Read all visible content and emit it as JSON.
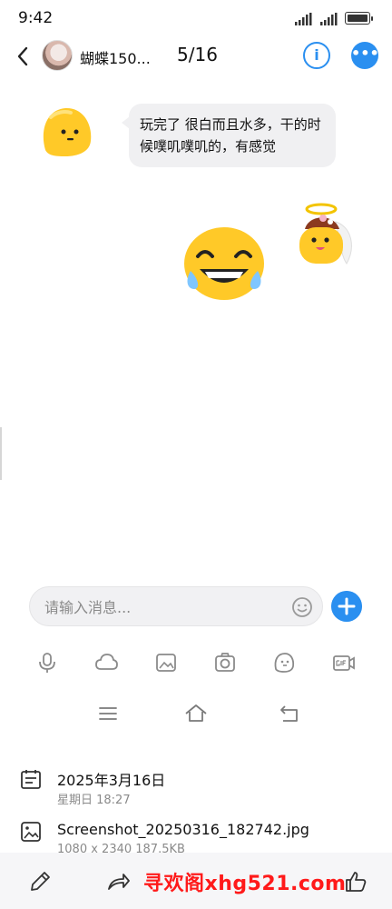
{
  "status_bar": {
    "time": "9:42"
  },
  "header": {
    "contact_name": "蝴蝶150...",
    "counter": "5/16",
    "info_icon": "info-icon",
    "more_icon": "more-icon"
  },
  "chat": {
    "incoming_message": "玩完了 很白而且水多，干的时候噗叽噗叽的，有感觉",
    "incoming_avatar": "yellow-blob-emoji",
    "sticker_angel": "angel-emoji-sticker",
    "sticker_laugh": "laughing-tears-emoji"
  },
  "composer": {
    "placeholder": "请输入消息...",
    "emoji_icon": "smile-icon",
    "send_icon": "plus-icon"
  },
  "toolbar": [
    "microphone-icon",
    "cloud-icon",
    "image-icon",
    "camera-icon",
    "sticker-icon",
    "gif-icon"
  ],
  "system_nav": [
    "menu-icon",
    "home-icon",
    "back-icon"
  ],
  "file_info": {
    "date": "2025年3月16日",
    "day_time": "星期日 18:27",
    "filename": "Screenshot_20250316_182742.jpg",
    "details": "1080 x 2340 187.5KB"
  },
  "bottom_actions": [
    "edit-icon",
    "share-icon",
    "like-icon"
  ],
  "watermark": "寻欢阁xhg521.com",
  "colors": {
    "accent": "#2a8ff0",
    "bubble": "#f0f0f2",
    "watermark": "#ff1a1a",
    "emoji_yellow": "#ffc928"
  }
}
